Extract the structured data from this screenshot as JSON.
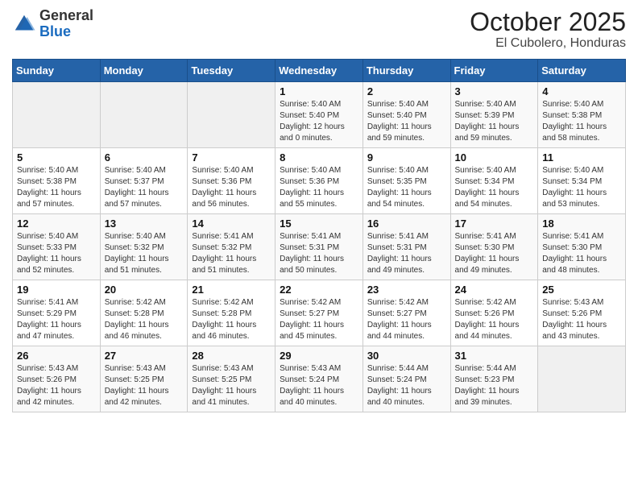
{
  "logo": {
    "general": "General",
    "blue": "Blue"
  },
  "title": "October 2025",
  "subtitle": "El Cubolero, Honduras",
  "weekdays": [
    "Sunday",
    "Monday",
    "Tuesday",
    "Wednesday",
    "Thursday",
    "Friday",
    "Saturday"
  ],
  "weeks": [
    [
      {
        "day": "",
        "info": ""
      },
      {
        "day": "",
        "info": ""
      },
      {
        "day": "",
        "info": ""
      },
      {
        "day": "1",
        "info": "Sunrise: 5:40 AM\nSunset: 5:40 PM\nDaylight: 12 hours\nand 0 minutes."
      },
      {
        "day": "2",
        "info": "Sunrise: 5:40 AM\nSunset: 5:40 PM\nDaylight: 11 hours\nand 59 minutes."
      },
      {
        "day": "3",
        "info": "Sunrise: 5:40 AM\nSunset: 5:39 PM\nDaylight: 11 hours\nand 59 minutes."
      },
      {
        "day": "4",
        "info": "Sunrise: 5:40 AM\nSunset: 5:38 PM\nDaylight: 11 hours\nand 58 minutes."
      }
    ],
    [
      {
        "day": "5",
        "info": "Sunrise: 5:40 AM\nSunset: 5:38 PM\nDaylight: 11 hours\nand 57 minutes."
      },
      {
        "day": "6",
        "info": "Sunrise: 5:40 AM\nSunset: 5:37 PM\nDaylight: 11 hours\nand 57 minutes."
      },
      {
        "day": "7",
        "info": "Sunrise: 5:40 AM\nSunset: 5:36 PM\nDaylight: 11 hours\nand 56 minutes."
      },
      {
        "day": "8",
        "info": "Sunrise: 5:40 AM\nSunset: 5:36 PM\nDaylight: 11 hours\nand 55 minutes."
      },
      {
        "day": "9",
        "info": "Sunrise: 5:40 AM\nSunset: 5:35 PM\nDaylight: 11 hours\nand 54 minutes."
      },
      {
        "day": "10",
        "info": "Sunrise: 5:40 AM\nSunset: 5:34 PM\nDaylight: 11 hours\nand 54 minutes."
      },
      {
        "day": "11",
        "info": "Sunrise: 5:40 AM\nSunset: 5:34 PM\nDaylight: 11 hours\nand 53 minutes."
      }
    ],
    [
      {
        "day": "12",
        "info": "Sunrise: 5:40 AM\nSunset: 5:33 PM\nDaylight: 11 hours\nand 52 minutes."
      },
      {
        "day": "13",
        "info": "Sunrise: 5:40 AM\nSunset: 5:32 PM\nDaylight: 11 hours\nand 51 minutes."
      },
      {
        "day": "14",
        "info": "Sunrise: 5:41 AM\nSunset: 5:32 PM\nDaylight: 11 hours\nand 51 minutes."
      },
      {
        "day": "15",
        "info": "Sunrise: 5:41 AM\nSunset: 5:31 PM\nDaylight: 11 hours\nand 50 minutes."
      },
      {
        "day": "16",
        "info": "Sunrise: 5:41 AM\nSunset: 5:31 PM\nDaylight: 11 hours\nand 49 minutes."
      },
      {
        "day": "17",
        "info": "Sunrise: 5:41 AM\nSunset: 5:30 PM\nDaylight: 11 hours\nand 49 minutes."
      },
      {
        "day": "18",
        "info": "Sunrise: 5:41 AM\nSunset: 5:30 PM\nDaylight: 11 hours\nand 48 minutes."
      }
    ],
    [
      {
        "day": "19",
        "info": "Sunrise: 5:41 AM\nSunset: 5:29 PM\nDaylight: 11 hours\nand 47 minutes."
      },
      {
        "day": "20",
        "info": "Sunrise: 5:42 AM\nSunset: 5:28 PM\nDaylight: 11 hours\nand 46 minutes."
      },
      {
        "day": "21",
        "info": "Sunrise: 5:42 AM\nSunset: 5:28 PM\nDaylight: 11 hours\nand 46 minutes."
      },
      {
        "day": "22",
        "info": "Sunrise: 5:42 AM\nSunset: 5:27 PM\nDaylight: 11 hours\nand 45 minutes."
      },
      {
        "day": "23",
        "info": "Sunrise: 5:42 AM\nSunset: 5:27 PM\nDaylight: 11 hours\nand 44 minutes."
      },
      {
        "day": "24",
        "info": "Sunrise: 5:42 AM\nSunset: 5:26 PM\nDaylight: 11 hours\nand 44 minutes."
      },
      {
        "day": "25",
        "info": "Sunrise: 5:43 AM\nSunset: 5:26 PM\nDaylight: 11 hours\nand 43 minutes."
      }
    ],
    [
      {
        "day": "26",
        "info": "Sunrise: 5:43 AM\nSunset: 5:26 PM\nDaylight: 11 hours\nand 42 minutes."
      },
      {
        "day": "27",
        "info": "Sunrise: 5:43 AM\nSunset: 5:25 PM\nDaylight: 11 hours\nand 42 minutes."
      },
      {
        "day": "28",
        "info": "Sunrise: 5:43 AM\nSunset: 5:25 PM\nDaylight: 11 hours\nand 41 minutes."
      },
      {
        "day": "29",
        "info": "Sunrise: 5:43 AM\nSunset: 5:24 PM\nDaylight: 11 hours\nand 40 minutes."
      },
      {
        "day": "30",
        "info": "Sunrise: 5:44 AM\nSunset: 5:24 PM\nDaylight: 11 hours\nand 40 minutes."
      },
      {
        "day": "31",
        "info": "Sunrise: 5:44 AM\nSunset: 5:23 PM\nDaylight: 11 hours\nand 39 minutes."
      },
      {
        "day": "",
        "info": ""
      }
    ]
  ]
}
